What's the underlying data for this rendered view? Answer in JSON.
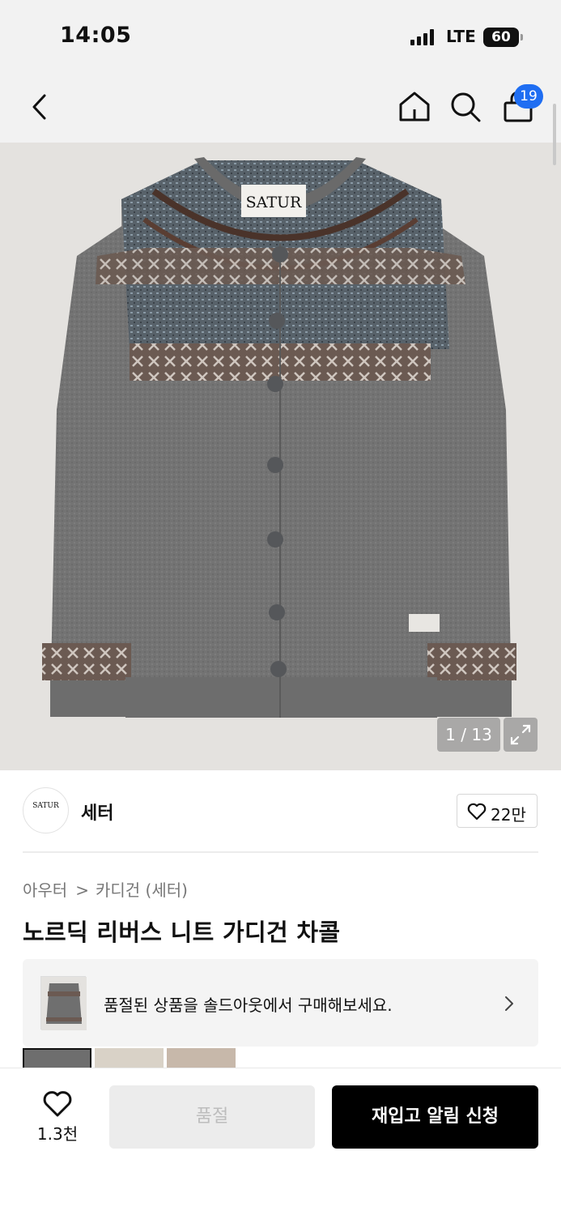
{
  "status_bar": {
    "time": "14:05",
    "network": "LTE",
    "battery": "60"
  },
  "nav": {
    "cart_badge": "19"
  },
  "gallery": {
    "counter": "1 / 13",
    "garment_label": "SATUR"
  },
  "brand": {
    "logo_text": "SATUR",
    "name": "세터",
    "like_count": "22만"
  },
  "breadcrumb": {
    "level1": "아우터",
    "separator": ">",
    "level2": "카디건 (세터)"
  },
  "product": {
    "title": "노르딕 리버스 니트 가디건 차콜"
  },
  "soldout_banner": {
    "text": "품절된 상품을 솔드아웃에서 구매해보세요."
  },
  "bottom": {
    "wish_count": "1.3천",
    "soldout_label": "품절",
    "restock_label": "재입고 알림 신청"
  },
  "colors": {
    "badge": "#1f6ef2",
    "primary_button": "#000000",
    "disabled_button": "#ececec"
  }
}
